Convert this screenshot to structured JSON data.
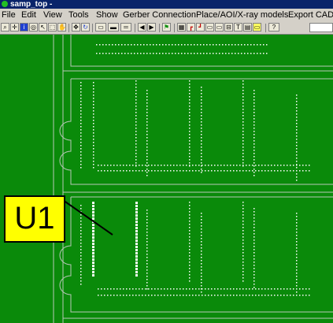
{
  "window": {
    "title": "samp_top -"
  },
  "menu": [
    "File",
    "Edit",
    "View",
    "Tools",
    "Show",
    "Gerber Connection",
    "Place/AOI/X-ray models",
    "Export CAD"
  ],
  "toolbar": {
    "icons": [
      "search-icon",
      "zoom-icon",
      "info-icon",
      "target-icon",
      "pointer-icon",
      "select-icon",
      "pan-icon",
      "move-icon",
      "refresh-icon",
      "layer-icon",
      "layer-icon",
      "layer-icon",
      "prev-icon",
      "next-icon",
      "flag-icon",
      "grid-icon",
      "part-icon",
      "part-icon",
      "part-icon",
      "part-icon",
      "text-icon",
      "part-icon",
      "part-icon",
      "help-icon"
    ]
  },
  "callout": {
    "label": "U1"
  },
  "colors": {
    "board": "#0a8a0a",
    "outline": "#b8c8b8",
    "pads": "#ffffff",
    "callout": "#ffff00",
    "titlebar": "#0a246a"
  }
}
